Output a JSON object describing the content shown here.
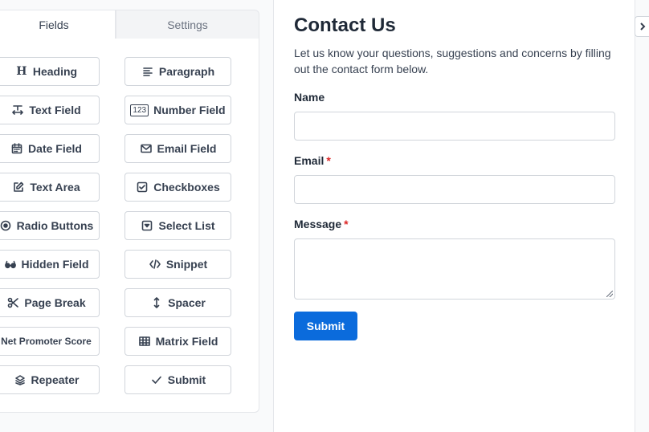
{
  "tabs": {
    "fields": "Fields",
    "settings": "Settings"
  },
  "fields": [
    {
      "label": "Heading",
      "icon": "heading-icon"
    },
    {
      "label": "Paragraph",
      "icon": "paragraph-icon"
    },
    {
      "label": "Text Field",
      "icon": "text-field-icon"
    },
    {
      "label": "Number Field",
      "icon": "number-field-icon",
      "icon_text": "123"
    },
    {
      "label": "Date Field",
      "icon": "calendar-icon"
    },
    {
      "label": "Email Field",
      "icon": "envelope-icon"
    },
    {
      "label": "Text Area",
      "icon": "edit-icon"
    },
    {
      "label": "Checkboxes",
      "icon": "checkbox-icon"
    },
    {
      "label": "Radio Buttons",
      "icon": "radio-icon"
    },
    {
      "label": "Select List",
      "icon": "select-icon"
    },
    {
      "label": "Hidden Field",
      "icon": "glasses-icon"
    },
    {
      "label": "Snippet",
      "icon": "code-icon"
    },
    {
      "label": "Page Break",
      "icon": "scissors-icon"
    },
    {
      "label": "Spacer",
      "icon": "vertical-arrows-icon"
    },
    {
      "label": "Net Promoter Score",
      "icon": ""
    },
    {
      "label": "Matrix Field",
      "icon": "table-icon"
    },
    {
      "label": "Repeater",
      "icon": "layers-icon"
    },
    {
      "label": "Submit",
      "icon": "check-icon"
    }
  ],
  "form": {
    "title": "Contact Us",
    "description": "Let us know your questions, suggestions and concerns by filling out the contact form below.",
    "name_label": "Name",
    "email_label": "Email",
    "message_label": "Message",
    "required_mark": "*",
    "submit_label": "Submit"
  },
  "colors": {
    "primary": "#0b6bdc",
    "required": "#dc2626",
    "border": "#d1d5db"
  }
}
